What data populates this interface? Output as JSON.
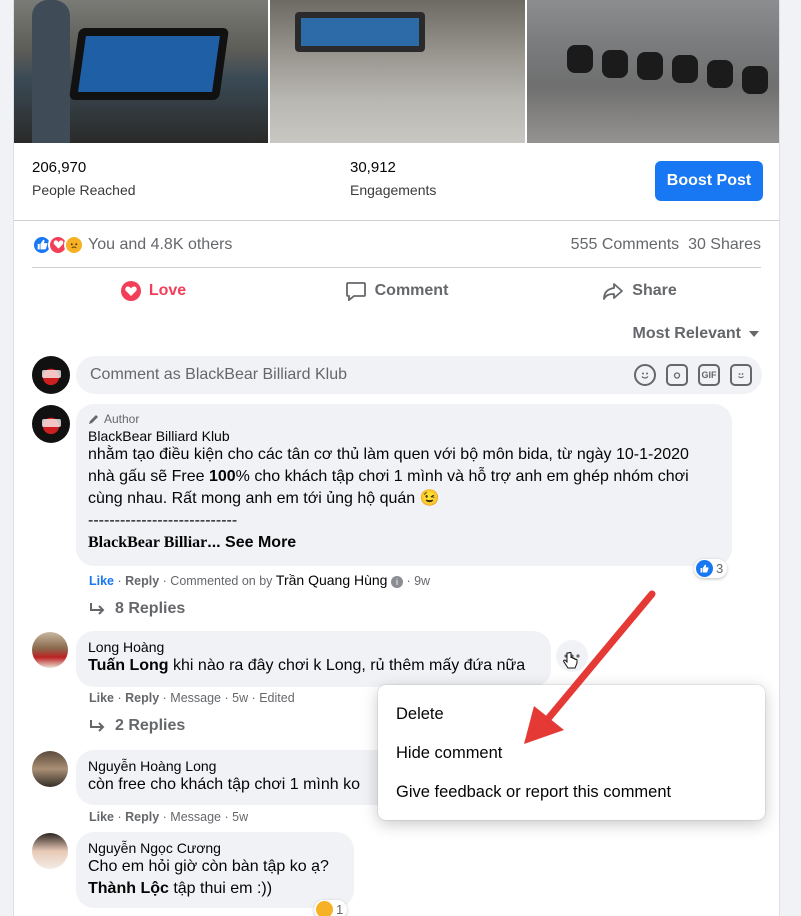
{
  "stats": {
    "reached_value": "206,970",
    "reached_label": "People Reached",
    "engagements_value": "30,912",
    "engagements_label": "Engagements",
    "boost_label": "Boost Post"
  },
  "reactions": {
    "summary": "You and 4.8K others",
    "comments_count": "555 Comments",
    "shares_count": "30 Shares",
    "icons": [
      "like-icon",
      "love-icon",
      "sad-icon"
    ]
  },
  "actions": {
    "love": "Love",
    "comment": "Comment",
    "share": "Share"
  },
  "sort_label": "Most Relevant",
  "composer": {
    "placeholder": "Comment as BlackBear Billiard Klub",
    "icons": [
      "emoji-icon",
      "camera-icon",
      "gif-icon",
      "sticker-icon"
    ],
    "gif_text": "GIF"
  },
  "comments": [
    {
      "author_tag": "Author",
      "name": "BlackBear Billiard Klub",
      "text_line1": "nhằm tạo điều kiện cho các tân cơ thủ làm quen với bộ môn bida, từ ngày 10-1-2020 nhà gấu sẽ Free ",
      "text_bold": "100",
      "text_line2": "% cho khách tập chơi 1 mình và hỗ trợ anh em ghép nhóm chơi cùng nhau. Rất mong anh em tới ủng hộ quán 😉",
      "divider": "----------------------------",
      "bold_preview": "BlackBear Billiar",
      "see_more": "... See More",
      "like": "Like",
      "reply": "Reply",
      "meta_rest": "· Commented on by",
      "commenter": "Trần Quang Hùng",
      "time": "· 9w",
      "reaction_count": "3",
      "replies": "8 Replies"
    },
    {
      "name": "Long Hoàng",
      "mention": "Tuấn Long",
      "text": " khi nào ra đây chơi k Long, rủ thêm mấy đứa nữa",
      "like": "Like",
      "reply": "Reply",
      "meta_rest": "· Message · 5w · Edited",
      "replies": "2 Replies"
    },
    {
      "name": "Nguyễn Hoàng Long",
      "text": "còn free cho khách tập chơi 1 mình ko",
      "like": "Like",
      "reply": "Reply",
      "meta_rest": "· Message · 5w"
    },
    {
      "name": "Nguyễn Ngọc Cương",
      "text_line1": "Cho em hỏi giờ còn bàn tập ko ạ?",
      "mention": "Thành Lộc",
      "text_line2": " tập thui em :))",
      "reaction_count": "1"
    }
  ],
  "menu": {
    "items": [
      "Delete",
      "Hide comment",
      "Give feedback or report this comment"
    ]
  },
  "accent_colors": {
    "brand_blue": "#1877f2",
    "love_red": "#f33e58",
    "annotation_arrow": "#e53935"
  }
}
